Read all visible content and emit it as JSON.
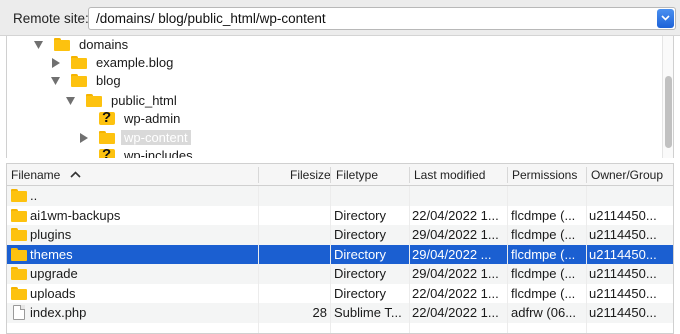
{
  "remote_site": {
    "label": "Remote site:",
    "path": "/domains/ blog/public_html/wp-content"
  },
  "tree": [
    {
      "label": "domains",
      "expanded": true,
      "icon": "folder-icon"
    },
    {
      "label": "example.blog",
      "expanded": false,
      "icon": "folder-icon"
    },
    {
      "label": "blog",
      "expanded": true,
      "icon": "folder-icon"
    },
    {
      "label": "public_html",
      "expanded": true,
      "icon": "folder-icon"
    },
    {
      "label": "wp-admin",
      "icon": "unknown-folder-icon"
    },
    {
      "label": "wp-content",
      "expanded": false,
      "selected": true,
      "icon": "folder-icon"
    },
    {
      "label": "wp-includes",
      "icon": "unknown-folder-icon"
    }
  ],
  "list": {
    "columns": {
      "filename": "Filename",
      "filesize": "Filesize",
      "filetype": "Filetype",
      "modified": "Last modified",
      "permissions": "Permissions",
      "owner": "Owner/Group"
    },
    "sort_column": "Filename",
    "rows": [
      {
        "name": "..",
        "size": "",
        "type": "",
        "modified": "",
        "perms": "",
        "owner": "",
        "icon": "folder-icon"
      },
      {
        "name": "ai1wm-backups",
        "size": "",
        "type": "Directory",
        "modified": "22/04/2022 1...",
        "perms": "flcdmpe (...",
        "owner": "u2114450...",
        "icon": "folder-icon"
      },
      {
        "name": "plugins",
        "size": "",
        "type": "Directory",
        "modified": "29/04/2022 1...",
        "perms": "flcdmpe (...",
        "owner": "u2114450...",
        "icon": "folder-icon"
      },
      {
        "name": "themes",
        "size": "",
        "type": "Directory",
        "modified": "29/04/2022 ...",
        "perms": "flcdmpe (...",
        "owner": "u2114450...",
        "icon": "folder-icon",
        "selected": true
      },
      {
        "name": "upgrade",
        "size": "",
        "type": "Directory",
        "modified": "29/04/2022 1...",
        "perms": "flcdmpe (...",
        "owner": "u2114450...",
        "icon": "folder-icon"
      },
      {
        "name": "uploads",
        "size": "",
        "type": "Directory",
        "modified": "22/04/2022 1...",
        "perms": "flcdmpe (...",
        "owner": "u2114450...",
        "icon": "folder-icon"
      },
      {
        "name": "index.php",
        "size": "28",
        "type": "Sublime T...",
        "modified": "22/04/2022 1...",
        "perms": "adfrw (06...",
        "owner": "u2114450...",
        "icon": "file-icon"
      }
    ]
  },
  "colors": {
    "selection": "#1b5fd1",
    "folder": "#fdc20f",
    "combo_button": "#1d62d8"
  }
}
